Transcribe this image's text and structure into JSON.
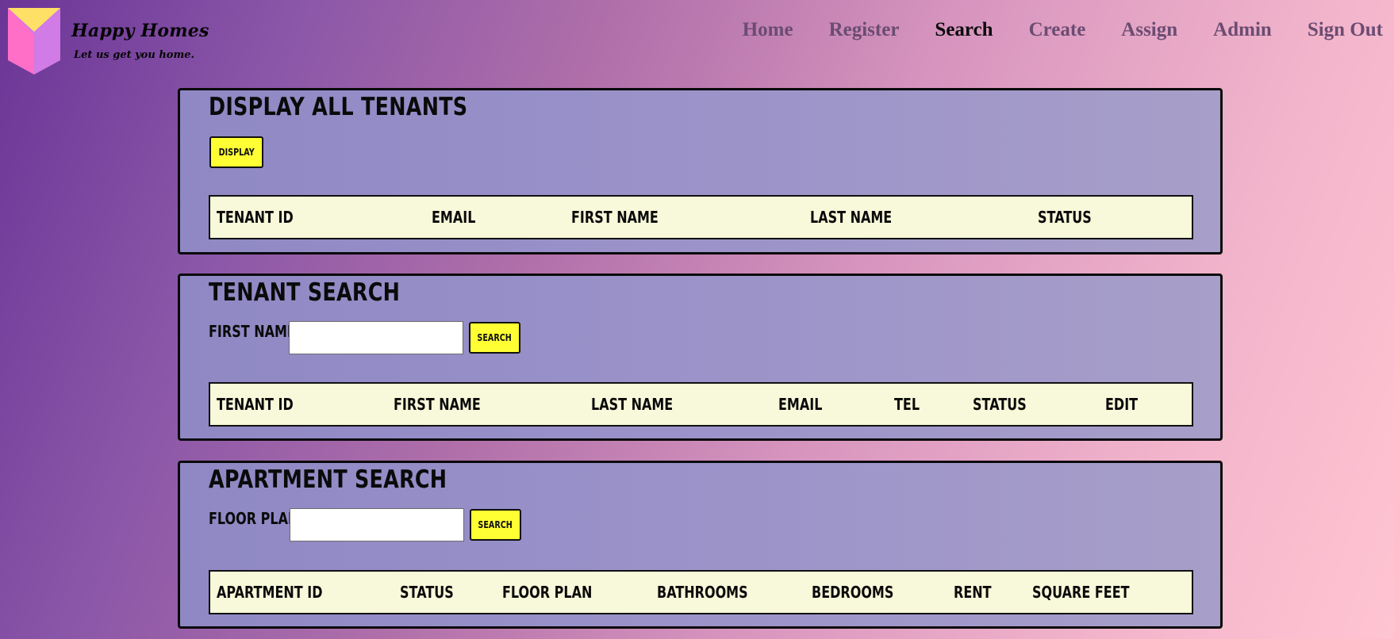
{
  "brand": {
    "title": "Happy Homes",
    "tagline": "Let us get you home.",
    "logo_icon": "house-cube-logo",
    "colors": {
      "logo_top": "#ffe066",
      "logo_left": "#ff6ec7",
      "logo_right": "#d07be6"
    }
  },
  "nav": {
    "items": [
      "Home",
      "Register",
      "Search",
      "Create",
      "Assign",
      "Admin",
      "Sign Out"
    ],
    "active": "Search"
  },
  "display_all": {
    "title": "DISPLAY ALL TENANTS",
    "button_label": "DISPLAY",
    "columns": [
      "TENANT ID",
      "EMAIL",
      "FIRST NAME",
      "LAST NAME",
      "STATUS"
    ]
  },
  "tenant_search": {
    "title": "TENANT SEARCH",
    "field_label": "FIRST NAME",
    "field_value": "",
    "button_label": "SEARCH",
    "columns": [
      "TENANT ID",
      "FIRST NAME",
      "LAST NAME",
      "EMAIL",
      "TEL",
      "STATUS",
      "EDIT"
    ]
  },
  "apartment_search": {
    "title": "APARTMENT SEARCH",
    "field_label": "FLOOR PLAN",
    "field_value": "",
    "button_label": "SEARCH",
    "columns": [
      "APARTMENT ID",
      "STATUS",
      "FLOOR PLAN",
      "BATHROOMS",
      "BEDROOMS",
      "RENT",
      "SQUARE FEET"
    ]
  },
  "colors": {
    "button_yellow": "#ffff33",
    "table_header_bg": "#f8f8da",
    "panel_bg": "#9b93c9"
  }
}
